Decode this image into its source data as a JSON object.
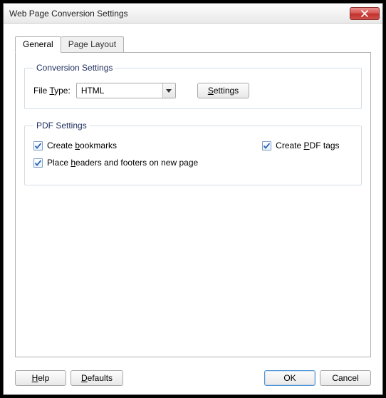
{
  "window": {
    "title": "Web Page Conversion Settings"
  },
  "tabs": {
    "general": "General",
    "page_layout": "Page Layout"
  },
  "conversion_settings": {
    "legend": "Conversion Settings",
    "file_type_label_pre": "File ",
    "file_type_label_key": "T",
    "file_type_label_post": "ype:",
    "file_type_value": "HTML",
    "settings_button_pre": "",
    "settings_button_key": "S",
    "settings_button_post": "ettings"
  },
  "pdf_settings": {
    "legend": "PDF Settings",
    "create_bookmarks_pre": "Create ",
    "create_bookmarks_key": "b",
    "create_bookmarks_post": "ookmarks",
    "create_pdf_tags_pre": "Create ",
    "create_pdf_tags_key": "P",
    "create_pdf_tags_post": "DF tags",
    "headers_footers_pre": "Place ",
    "headers_footers_key": "h",
    "headers_footers_post": "eaders and footers on new page"
  },
  "footer": {
    "help_pre": "",
    "help_key": "H",
    "help_post": "elp",
    "defaults_pre": "",
    "defaults_key": "D",
    "defaults_post": "efaults",
    "ok": "OK",
    "cancel": "Cancel"
  }
}
